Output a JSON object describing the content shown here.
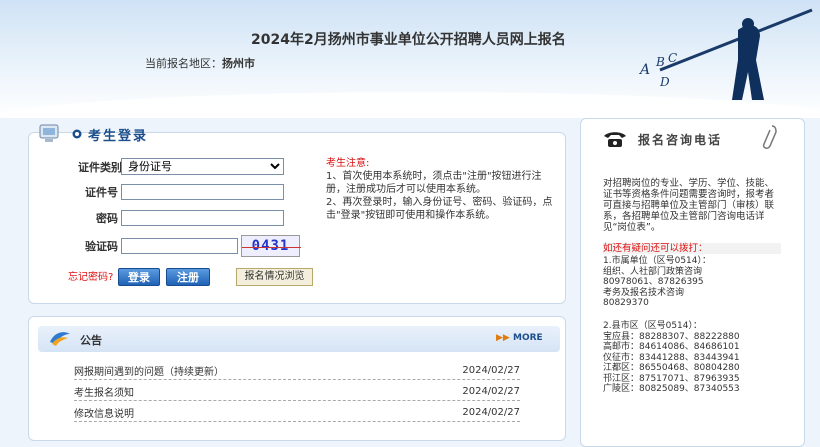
{
  "header": {
    "title": "2024年2月扬州市事业单位公开招聘人员网上报名",
    "region_label": "当前报名地区：",
    "region_value": "扬州市"
  },
  "login": {
    "title": "考生登录",
    "id_type_label": "证件类别",
    "id_type_value": "身份证号",
    "id_number_label": "证件号",
    "password_label": "密码",
    "captcha_label": "验证码",
    "captcha_text": "0431",
    "forgot_link": "忘记密码?",
    "login_button": "登录",
    "register_button": "注册",
    "browse_button": "报名情况浏览",
    "notes_title": "考生注意:",
    "notes_1": "1、首次使用本系统时，须点击\"注册\"按钮进行注册，注册成功后才可以使用本系统。",
    "notes_2": "2、再次登录时，输入身份证号、密码、验证码，点击\"登录\"按钮即可使用和操作本系统。"
  },
  "notice": {
    "title": "公告",
    "more": "MORE",
    "items": [
      {
        "title": "网报期间遇到的问题（持续更新）",
        "date": "2024/02/27"
      },
      {
        "title": "考生报名须知",
        "date": "2024/02/27"
      },
      {
        "title": "修改信息说明",
        "date": "2024/02/27"
      }
    ]
  },
  "contact": {
    "title": "报名咨询电话",
    "intro": "对招聘岗位的专业、学历、学位、技能、证书等资格条件问题需要咨询时，报考者可直接与招聘单位及主管部门（审核）联系，各招聘单位及主管部门咨询电话详见“岗位表”。",
    "more_heading": "如还有疑问还可以拨打：",
    "list1": [
      "1.市属单位（区号0514）：",
      "组织、人社部门政策咨询",
      "80978061、87826395",
      "考务及报名技术咨询",
      "80829370"
    ],
    "list2": [
      "2.县市区（区号0514）：",
      "宝应县：88288307、88222880",
      "高邮市：84614086、84686101",
      "仪征市：83441288、83443941",
      "江都区：86550468、80804280",
      "邗江区：87517071、87963935",
      "广陵区：80825089、87340553"
    ]
  },
  "deco": {
    "letters": "A B C D"
  },
  "colors": {
    "accent": "#1c4f8c",
    "alert": "#d11111",
    "button": "#1f62b6"
  }
}
